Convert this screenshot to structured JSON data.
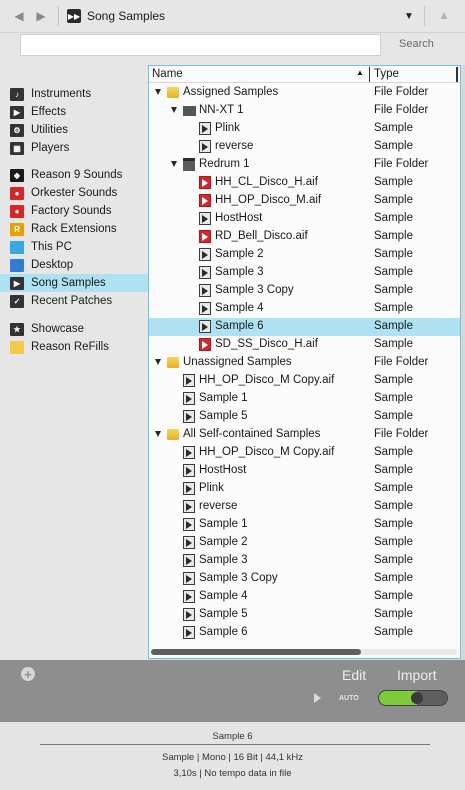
{
  "toolbar": {
    "location_title": "Song Samples",
    "back_icon": "back-arrow-icon",
    "forward_icon": "forward-arrow-icon",
    "location_icon": "song-samples-icon",
    "dropdown_icon": "chevron-down-icon",
    "up_icon": "up-arrow-icon"
  },
  "search": {
    "value": "",
    "placeholder": "",
    "button_label": "Search"
  },
  "sidebar": {
    "items": [
      {
        "label": "Instruments",
        "icon": "instruments-icon",
        "color": "#333333",
        "active": false
      },
      {
        "label": "Effects",
        "icon": "effects-icon",
        "color": "#333333",
        "active": false
      },
      {
        "label": "Utilities",
        "icon": "utilities-icon",
        "color": "#333333",
        "active": false
      },
      {
        "label": "Players",
        "icon": "players-icon",
        "color": "#333333",
        "active": false
      },
      {
        "label": "Reason 9 Sounds",
        "icon": "reason-sounds-icon",
        "color": "#1a1a1a",
        "active": false
      },
      {
        "label": "Orkester Sounds",
        "icon": "orkester-sounds-icon",
        "color": "#d4272b",
        "active": false
      },
      {
        "label": "Factory Sounds",
        "icon": "factory-sounds-icon",
        "color": "#d4272b",
        "active": false
      },
      {
        "label": "Rack Extensions",
        "icon": "rack-extensions-icon",
        "color": "#e8a100",
        "active": false
      },
      {
        "label": "This PC",
        "icon": "this-pc-icon",
        "color": "#3ba7e0",
        "active": false
      },
      {
        "label": "Desktop",
        "icon": "desktop-icon",
        "color": "#2e7cd4",
        "active": false
      },
      {
        "label": "Song Samples",
        "icon": "song-samples-icon",
        "color": "#333333",
        "active": true
      },
      {
        "label": "Recent Patches",
        "icon": "recent-patches-icon",
        "color": "#333333",
        "active": false
      },
      {
        "label": "Showcase",
        "icon": "showcase-star-icon",
        "color": "#333333",
        "active": false
      },
      {
        "label": "Reason ReFills",
        "icon": "refills-folder-icon",
        "color": "#f3c94a",
        "active": false
      }
    ]
  },
  "list": {
    "columns": {
      "name": "Name",
      "type": "Type",
      "sort_icon": "sort-ascending-icon"
    },
    "rows": [
      {
        "name": "Assigned Samples",
        "type": "File Folder",
        "kind": "folder",
        "depth": 0,
        "expanded": true,
        "selected": false
      },
      {
        "name": "NN-XT 1",
        "type": "File Folder",
        "kind": "nnxt",
        "depth": 1,
        "expanded": true,
        "selected": false
      },
      {
        "name": "Plink",
        "type": "Sample",
        "kind": "sample",
        "depth": 2,
        "expanded": false,
        "selected": false
      },
      {
        "name": "reverse",
        "type": "Sample",
        "kind": "sample",
        "depth": 2,
        "expanded": false,
        "selected": false
      },
      {
        "name": "Redrum 1",
        "type": "File Folder",
        "kind": "redrum",
        "depth": 1,
        "expanded": true,
        "selected": false
      },
      {
        "name": "HH_CL_Disco_H.aif",
        "type": "Sample",
        "kind": "red",
        "depth": 2,
        "expanded": false,
        "selected": false
      },
      {
        "name": "HH_OP_Disco_M.aif",
        "type": "Sample",
        "kind": "red",
        "depth": 2,
        "expanded": false,
        "selected": false
      },
      {
        "name": "HostHost",
        "type": "Sample",
        "kind": "sample",
        "depth": 2,
        "expanded": false,
        "selected": false
      },
      {
        "name": "RD_Bell_Disco.aif",
        "type": "Sample",
        "kind": "red",
        "depth": 2,
        "expanded": false,
        "selected": false
      },
      {
        "name": "Sample 2",
        "type": "Sample",
        "kind": "sample",
        "depth": 2,
        "expanded": false,
        "selected": false
      },
      {
        "name": "Sample 3",
        "type": "Sample",
        "kind": "sample",
        "depth": 2,
        "expanded": false,
        "selected": false
      },
      {
        "name": "Sample 3 Copy",
        "type": "Sample",
        "kind": "sample",
        "depth": 2,
        "expanded": false,
        "selected": false
      },
      {
        "name": "Sample 4",
        "type": "Sample",
        "kind": "sample",
        "depth": 2,
        "expanded": false,
        "selected": false
      },
      {
        "name": "Sample 6",
        "type": "Sample",
        "kind": "sample",
        "depth": 2,
        "expanded": false,
        "selected": true
      },
      {
        "name": "SD_SS_Disco_H.aif",
        "type": "Sample",
        "kind": "red",
        "depth": 2,
        "expanded": false,
        "selected": false
      },
      {
        "name": "Unassigned Samples",
        "type": "File Folder",
        "kind": "folder",
        "depth": 0,
        "expanded": true,
        "selected": false
      },
      {
        "name": "HH_OP_Disco_M Copy.aif",
        "type": "Sample",
        "kind": "sample",
        "depth": 1,
        "expanded": false,
        "selected": false
      },
      {
        "name": "Sample 1",
        "type": "Sample",
        "kind": "sample",
        "depth": 1,
        "expanded": false,
        "selected": false
      },
      {
        "name": "Sample 5",
        "type": "Sample",
        "kind": "sample",
        "depth": 1,
        "expanded": false,
        "selected": false
      },
      {
        "name": "All Self-contained Samples",
        "type": "File Folder",
        "kind": "folder",
        "depth": 0,
        "expanded": true,
        "selected": false
      },
      {
        "name": "HH_OP_Disco_M Copy.aif",
        "type": "Sample",
        "kind": "sample",
        "depth": 1,
        "expanded": false,
        "selected": false
      },
      {
        "name": "HostHost",
        "type": "Sample",
        "kind": "sample",
        "depth": 1,
        "expanded": false,
        "selected": false
      },
      {
        "name": "Plink",
        "type": "Sample",
        "kind": "sample",
        "depth": 1,
        "expanded": false,
        "selected": false
      },
      {
        "name": "reverse",
        "type": "Sample",
        "kind": "sample",
        "depth": 1,
        "expanded": false,
        "selected": false
      },
      {
        "name": "Sample 1",
        "type": "Sample",
        "kind": "sample",
        "depth": 1,
        "expanded": false,
        "selected": false
      },
      {
        "name": "Sample 2",
        "type": "Sample",
        "kind": "sample",
        "depth": 1,
        "expanded": false,
        "selected": false
      },
      {
        "name": "Sample 3",
        "type": "Sample",
        "kind": "sample",
        "depth": 1,
        "expanded": false,
        "selected": false
      },
      {
        "name": "Sample 3 Copy",
        "type": "Sample",
        "kind": "sample",
        "depth": 1,
        "expanded": false,
        "selected": false
      },
      {
        "name": "Sample 4",
        "type": "Sample",
        "kind": "sample",
        "depth": 1,
        "expanded": false,
        "selected": false
      },
      {
        "name": "Sample 5",
        "type": "Sample",
        "kind": "sample",
        "depth": 1,
        "expanded": false,
        "selected": false
      },
      {
        "name": "Sample 6",
        "type": "Sample",
        "kind": "sample",
        "depth": 1,
        "expanded": false,
        "selected": false
      }
    ]
  },
  "actions": {
    "add_icon": "add-circle-icon",
    "edit_label": "Edit",
    "import_label": "Import",
    "play_icon": "play-icon",
    "auto_label": "AUTO",
    "auto_on": true,
    "auto_color": "#7ecb3a"
  },
  "info": {
    "name": "Sample 6",
    "details": "Sample | Mono | 16 Bit | 44,1 kHz",
    "tempo": "3,10s | No tempo data in file"
  },
  "colors": {
    "selection": "#aee2f3",
    "panel_border": "#6cc4e2",
    "sample_red": "#d9242b"
  }
}
